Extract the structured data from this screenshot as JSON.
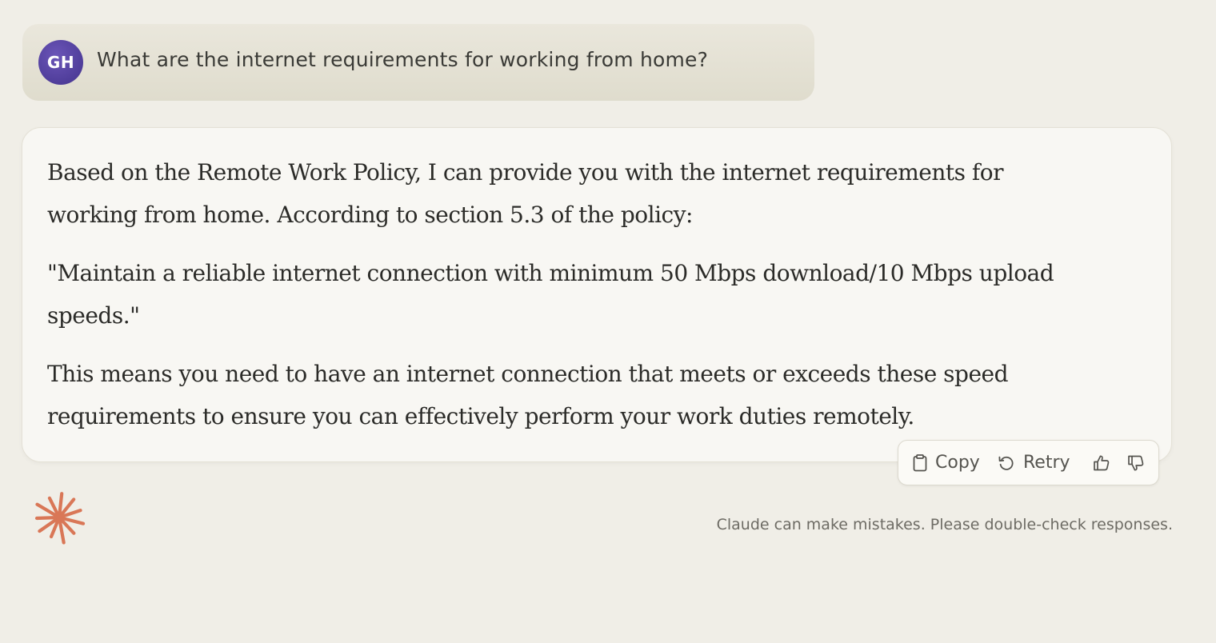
{
  "user_message": {
    "avatar_initials": "GH",
    "text": "What are the internet requirements for working from home?"
  },
  "assistant_message": {
    "paragraphs": [
      "Based on the Remote Work Policy, I can provide you with the internet requirements for working from home. According to section 5.3 of the policy:",
      "\"Maintain a reliable internet connection with minimum 50 Mbps download/10 Mbps upload speeds.\"",
      "This means you need to have an internet connection that meets or exceeds these speed requirements to ensure you can effectively perform your work duties remotely."
    ]
  },
  "actions": {
    "copy_label": "Copy",
    "retry_label": "Retry",
    "thumbs_up_icon": "thumbs-up-icon",
    "thumbs_down_icon": "thumbs-down-icon"
  },
  "footer": {
    "disclaimer": "Claude can make mistakes. Please double-check responses."
  },
  "colors": {
    "background": "#f0eee7",
    "user_bubble": "#e5e2d5",
    "avatar": "#5a46a8",
    "assistant_card": "#f8f7f3",
    "logo_accent": "#d97757"
  }
}
